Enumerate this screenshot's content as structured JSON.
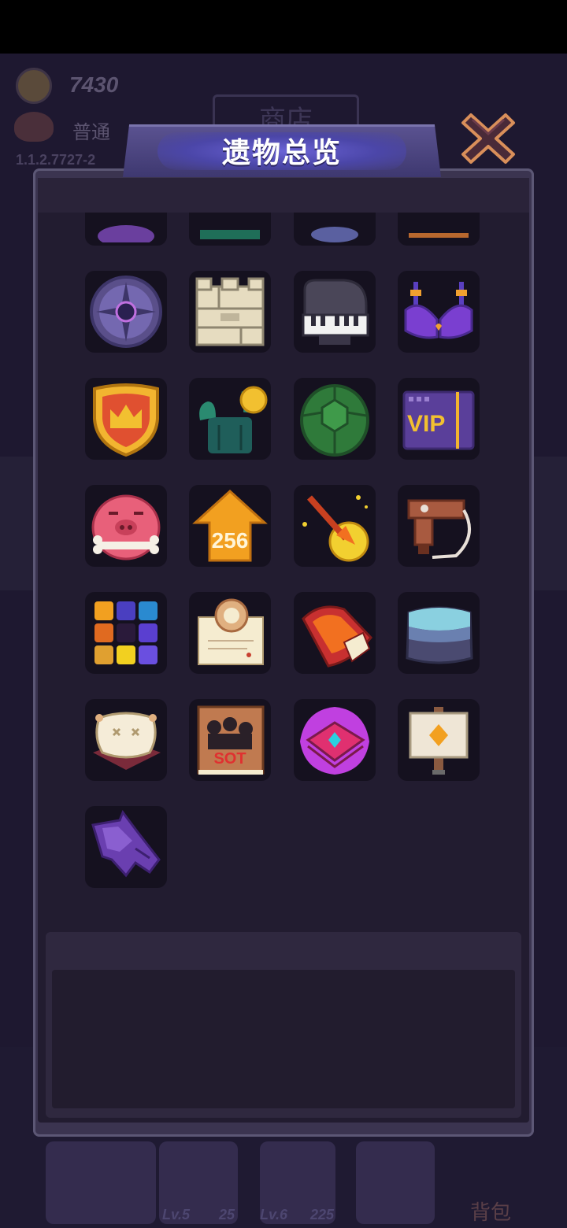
{
  "background": {
    "coins": "7430",
    "mode": "普通",
    "version": "1.1.2.7727-2",
    "shop_title": "商店",
    "slots": [
      {
        "level": "Lv.5",
        "count": "25"
      },
      {
        "level": "Lv.6",
        "count": "225"
      }
    ],
    "bag_label": "背包"
  },
  "dialog": {
    "title": "遗物总览",
    "close_icon": "close-x-icon"
  },
  "relics": [
    {
      "name": "purple-compass-icon"
    },
    {
      "name": "stone-wall-block-icon"
    },
    {
      "name": "grand-piano-icon"
    },
    {
      "name": "purple-bra-icon"
    },
    {
      "name": "gold-crown-shield-icon"
    },
    {
      "name": "cactus-coin-icon"
    },
    {
      "name": "turtle-shell-icon"
    },
    {
      "name": "vip-card-icon",
      "text": "VIP"
    },
    {
      "name": "pig-bone-icon"
    },
    {
      "name": "arrow-256-icon",
      "text": "256"
    },
    {
      "name": "fire-arrow-coin-icon"
    },
    {
      "name": "pistol-hook-icon"
    },
    {
      "name": "color-palette-icon"
    },
    {
      "name": "certificate-scroll-icon"
    },
    {
      "name": "flame-book-icon"
    },
    {
      "name": "ice-stone-block-icon"
    },
    {
      "name": "cushion-pillow-icon"
    },
    {
      "name": "gangster-book-icon",
      "text": "SOT"
    },
    {
      "name": "cursed-purple-book-icon"
    },
    {
      "name": "signpost-icon"
    },
    {
      "name": "purple-crystal-axe-icon"
    }
  ],
  "description": ""
}
